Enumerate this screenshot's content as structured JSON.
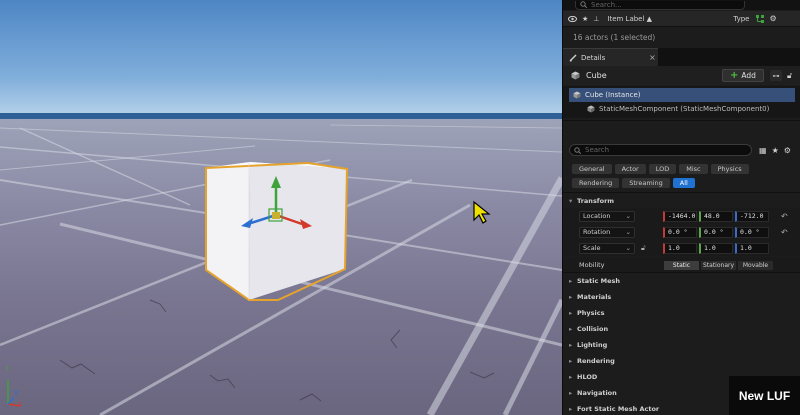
{
  "outliner": {
    "search_placeholder": "Search...",
    "column_item_label": "Item Label ▲",
    "column_type": "Type",
    "status": "16 actors (1 selected)"
  },
  "details": {
    "tab_label": "Details",
    "tab_close": "×",
    "actor_name": "Cube",
    "add_label": "Add",
    "hierarchy": {
      "root": "Cube (Instance)",
      "child": "StaticMeshComponent (StaticMeshComponent0)"
    },
    "search_placeholder": "Search",
    "filters_row1": [
      "General",
      "Actor",
      "LOD",
      "Misc",
      "Physics"
    ],
    "filters_row2": [
      "Rendering",
      "Streaming",
      "All"
    ],
    "active_filter": "All",
    "transform": {
      "header": "Transform",
      "location_label": "Location",
      "location": [
        "-1464.0",
        "48.0",
        "-712.0"
      ],
      "rotation_label": "Rotation",
      "rotation": [
        "0.0 °",
        "0.0 °",
        "0.0 °"
      ],
      "scale_label": "Scale",
      "scale": [
        "1.0",
        "1.0",
        "1.0"
      ],
      "mobility_label": "Mobility",
      "mobility_options": [
        "Static",
        "Stationary",
        "Movable"
      ],
      "mobility_selected": "Static"
    },
    "sections": [
      "Static Mesh",
      "Materials",
      "Physics",
      "Collision",
      "Lighting",
      "Rendering",
      "HLOD",
      "Navigation",
      "Fort Static Mesh Actor"
    ]
  },
  "watermark": "New LUF",
  "viewport": {
    "axis_x": "x",
    "axis_y": "y",
    "axis_z": "z"
  },
  "colors": {
    "selection_outline": "#e5a32b",
    "accent_blue": "#1f72cf",
    "axis_x": "#d33a2c",
    "axis_y": "#3fa33c",
    "axis_z": "#2c6fd1"
  }
}
